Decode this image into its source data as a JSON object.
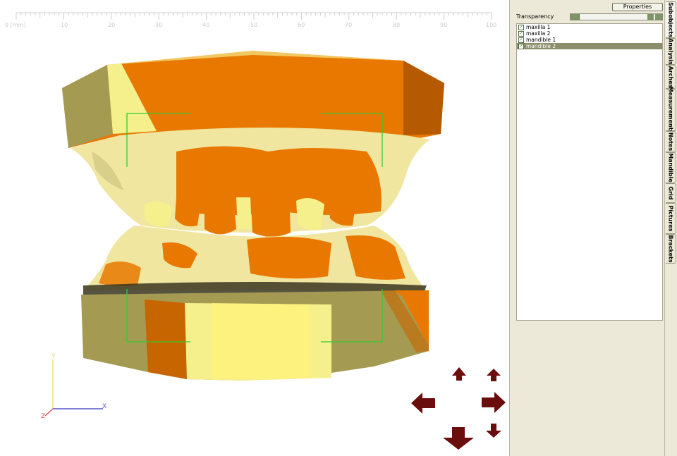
{
  "ruler": {
    "unit_label": "0 [mm]",
    "ticks": [
      "10",
      "20",
      "30",
      "40",
      "50",
      "60",
      "70",
      "80",
      "90",
      "100"
    ]
  },
  "axes": {
    "x": "X",
    "y": "Y",
    "z": "Z"
  },
  "nav_arrows": [
    "nav-up",
    "nav-up-small",
    "nav-left",
    "nav-right",
    "nav-down",
    "nav-down-small"
  ],
  "panel": {
    "properties_button": "Properties",
    "transparency_label": "Transparency",
    "objects": [
      {
        "label": "maxilla 1",
        "checked": true,
        "selected": false
      },
      {
        "label": "maxilla 2",
        "checked": true,
        "selected": false
      },
      {
        "label": "mandible 1",
        "checked": true,
        "selected": false
      },
      {
        "label": "mandible 2",
        "checked": true,
        "selected": true
      }
    ]
  },
  "tabs": [
    "Subobjects",
    "Analysis",
    "Arches",
    "Measurements",
    "Notes",
    "Mandible",
    "Grid",
    "Pictures",
    "Brackets"
  ],
  "colors": {
    "orange": "#e87800",
    "yellow": "#f5f08c",
    "olive": "#a59a52",
    "arrow": "#6b0d0d",
    "selection_box": "#33cc33",
    "selected_row": "#8b8e6a"
  }
}
